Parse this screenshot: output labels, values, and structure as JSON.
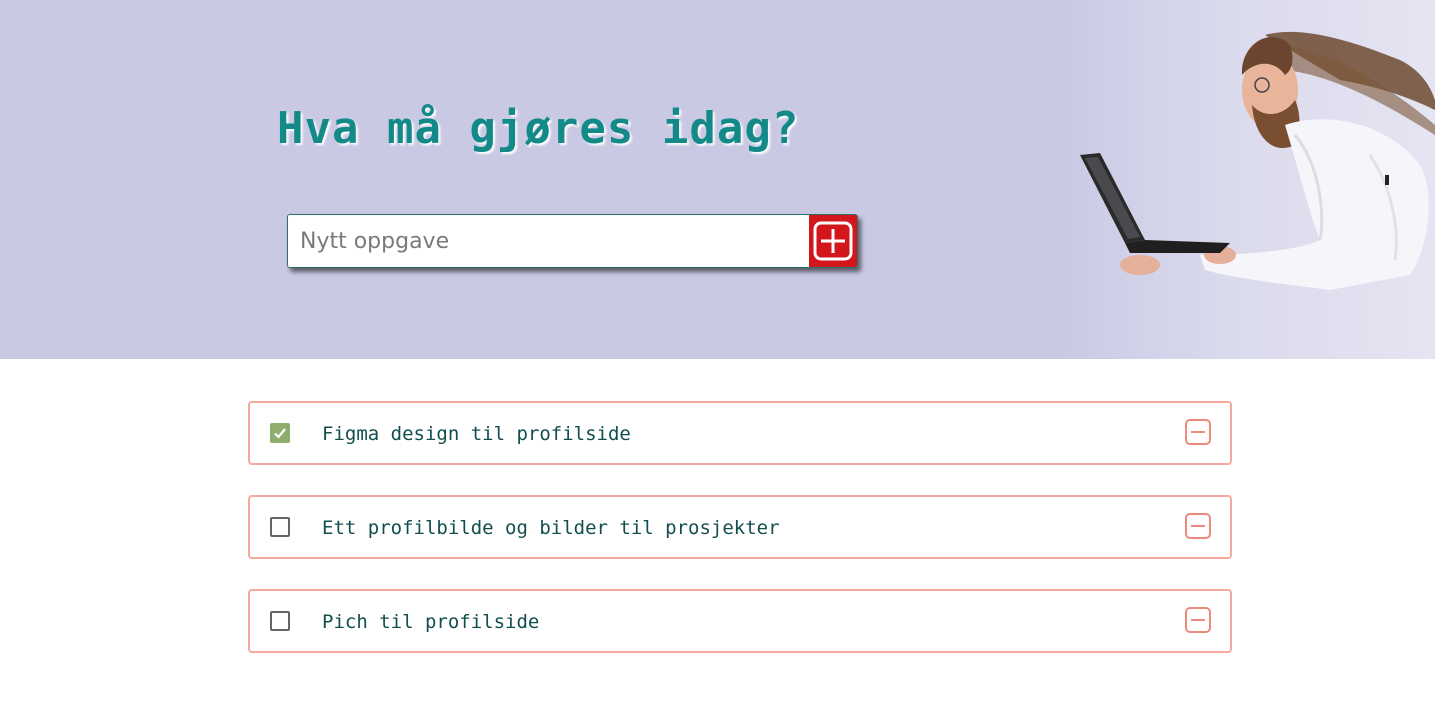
{
  "header": {
    "title": "Hva må gjøres idag?",
    "input_placeholder": "Nytt oppgave",
    "add_button_icon": "plus-icon",
    "illustration": "man-flying-with-laptop"
  },
  "tasks": [
    {
      "label": "Figma design til profilside",
      "checked": true
    },
    {
      "label": "Ett profilbilde og bilder til prosjekter",
      "checked": false
    },
    {
      "label": "Pich til profilside",
      "checked": false
    }
  ],
  "colors": {
    "hero_background": "#c9c9e4",
    "title": "#138a88",
    "add_button": "#d3161c",
    "task_border": "#f4a99c",
    "checked": "#8fae6e",
    "remove_icon": "#ee8a7b",
    "task_text": "#134e4e"
  }
}
